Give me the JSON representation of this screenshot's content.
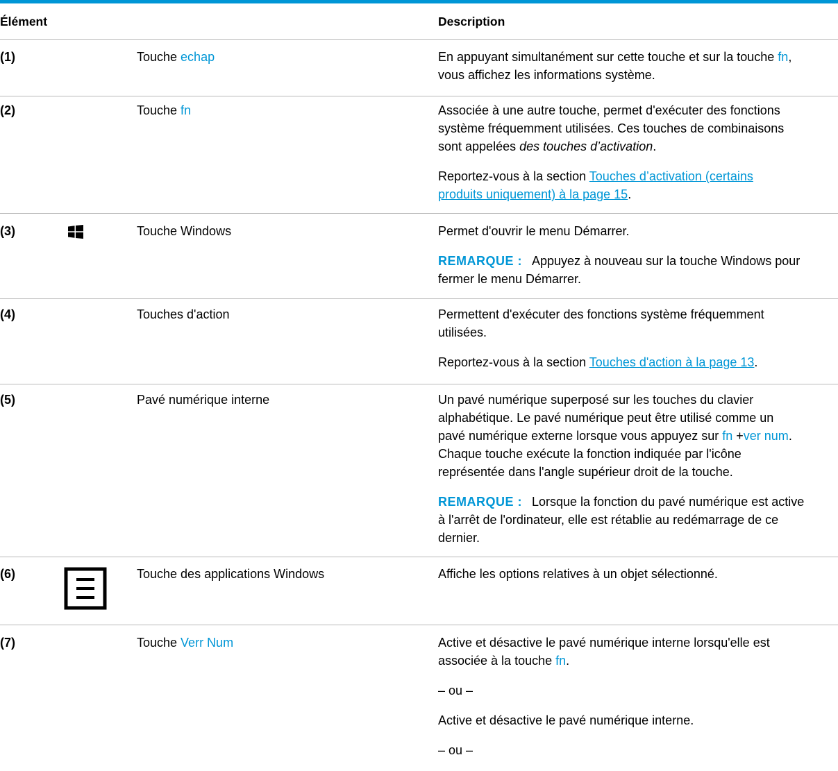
{
  "header": {
    "col_element": "Élément",
    "col_description": "Description"
  },
  "rows": [
    {
      "num": "(1)",
      "name_prefix": "Touche ",
      "name_key": "echap",
      "d1": "En appuyant simultanément sur cette touche et sur la touche ",
      "d1_key": "fn",
      "d1_end": ",",
      "d2": "vous affichez les informations système."
    },
    {
      "num": "(2)",
      "name_prefix": "Touche ",
      "name_key": "fn",
      "l1": "Associée à une autre touche, permet d'exécuter des fonctions",
      "l2": "système fréquemment utilisées. Ces touches de combinaisons",
      "l3": "sont appelées ",
      "l3_em": "des touches d’activation",
      "l3_end": ".",
      "ref_prefix": "Reportez-vous à la section ",
      "ref_link_a": "Touches d’activation (certains",
      "ref_link_b": "produits uniquement) à la page 15",
      "ref_end": "."
    },
    {
      "num": "(3)",
      "icon": "windows-logo-icon",
      "name": "Touche Windows",
      "d1": "Permet d'ouvrir le menu Démarrer.",
      "note_label": "REMARQUE :",
      "note_a": "Appuyez à nouveau sur la touche Windows pour",
      "note_b": "fermer le menu Démarrer."
    },
    {
      "num": "(4)",
      "name": "Touches d'action",
      "l1": "Permettent d'exécuter des fonctions système fréquemment",
      "l2": "utilisées.",
      "ref_prefix": "Reportez-vous à la section ",
      "ref_link": "Touches d'action à la page 13",
      "ref_end": "."
    },
    {
      "num": "(5)",
      "name": "Pavé numérique interne",
      "l1": "Un pavé numérique superposé sur les touches du clavier",
      "l2": "alphabétique. Le pavé numérique peut être utilisé comme un",
      "l3": "pavé numérique externe lorsque vous appuyez sur ",
      "l3_key1": "fn",
      "l3_plus": " +",
      "l3_key2": "ver num",
      "l3_end": ".",
      "l4": "Chaque touche exécute la fonction indiquée par l'icône",
      "l5": "représentée dans l'angle supérieur droit de la touche.",
      "note_label": "REMARQUE :",
      "note_a": "Lorsque la fonction du pavé numérique est active",
      "note_b": "à l'arrêt de l'ordinateur, elle est rétablie au redémarrage de ce",
      "note_c": "dernier."
    },
    {
      "num": "(6)",
      "icon": "windows-application-key-icon",
      "name": "Touche des applications Windows",
      "d1": "Affiche les options relatives à un objet sélectionné."
    },
    {
      "num": "(7)",
      "name_prefix": "Touche ",
      "name_key": "Verr Num",
      "l1": "Active et désactive le pavé numérique interne lorsqu'elle est",
      "l2": "associée à la touche ",
      "l2_key": "fn",
      "l2_end": ".",
      "or1": "– ou –",
      "alt": "Active et désactive le pavé numérique interne.",
      "or2": "– ou –"
    }
  ]
}
